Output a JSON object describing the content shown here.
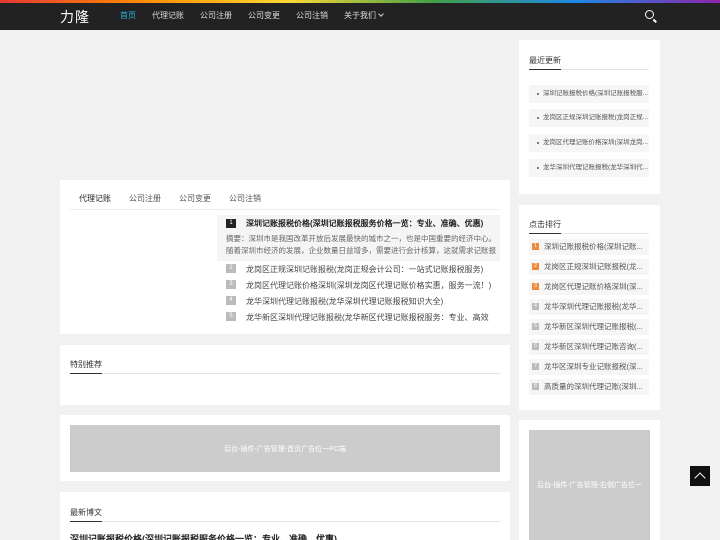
{
  "header": {
    "logo": "力隆",
    "nav": [
      {
        "label": "首页",
        "active": true
      },
      {
        "label": "代理记账",
        "active": false
      },
      {
        "label": "公司注册",
        "active": false
      },
      {
        "label": "公司变更",
        "active": false
      },
      {
        "label": "公司注销",
        "active": false
      },
      {
        "label": "关于我们",
        "active": false
      }
    ],
    "search_icon": "search-icon"
  },
  "tabs": [
    "代理记账",
    "公司注册",
    "公司变更",
    "公司注销"
  ],
  "highlight": {
    "num": "1",
    "title": "深圳记账报税价格(深圳记账报税服务价格一览：专业、准确、优惠)",
    "summary": "摘要：深圳市是我国改革开放后发展最快的城市之一，也是中国重要的经济中心。随着深圳市经济的发展，企业数量日益增多，需要进行会计核算，这就需求记账报税..."
  },
  "articles": [
    {
      "num": "2",
      "title": "龙岗区正规深圳记账报税(龙岗正规会计公司：一站式记账报税服务)"
    },
    {
      "num": "3",
      "title": "龙岗区代理记账价格深圳(深圳龙岗区代理记账价格实惠，服务一流！)"
    },
    {
      "num": "4",
      "title": "龙华深圳代理记账报税(龙华深圳代理记账报税知识大全)"
    },
    {
      "num": "5",
      "title": "龙华新区深圳代理记账报税(龙华新区代理记账报税服务：专业、高效"
    }
  ],
  "special": {
    "title": "特别推荐"
  },
  "ad_main": "后台-插件-广告管理-首页广告位一PC端",
  "latest": {
    "title": "最新博文",
    "first": "深圳记账报税价格(深圳记账报税服务价格一览：专业、准确、优惠)"
  },
  "recent": {
    "title": "最近更新",
    "items": [
      "深圳记账报税价格(深圳记账报税服...",
      "龙岗区正规深圳记账报税(龙岗正规...",
      "龙岗区代理记账价格深圳(深圳龙岗...",
      "龙华深圳代理记账报税(龙华深圳代..."
    ]
  },
  "ranking": {
    "title": "点击排行",
    "items": [
      {
        "num": "1",
        "label": "深圳记账报税价格(深圳记账..."
      },
      {
        "num": "2",
        "label": "龙岗区正规深圳记账报税(龙..."
      },
      {
        "num": "3",
        "label": "龙岗区代理记账价格深圳(深..."
      },
      {
        "num": "4",
        "label": "龙华深圳代理记账报税(龙华..."
      },
      {
        "num": "5",
        "label": "龙华新区深圳代理记账报税(..."
      },
      {
        "num": "6",
        "label": "龙华新区深圳代理记账咨询(..."
      },
      {
        "num": "7",
        "label": "龙华区深圳专业记账报税(深..."
      },
      {
        "num": "8",
        "label": "高质量的深圳代理记账(深圳..."
      }
    ]
  },
  "ad_side": "后台-插件-广告管理-右侧广告位一",
  "colors": {
    "accent": "#25b5e7",
    "hot": "#f08a3c",
    "header": "#222222"
  }
}
